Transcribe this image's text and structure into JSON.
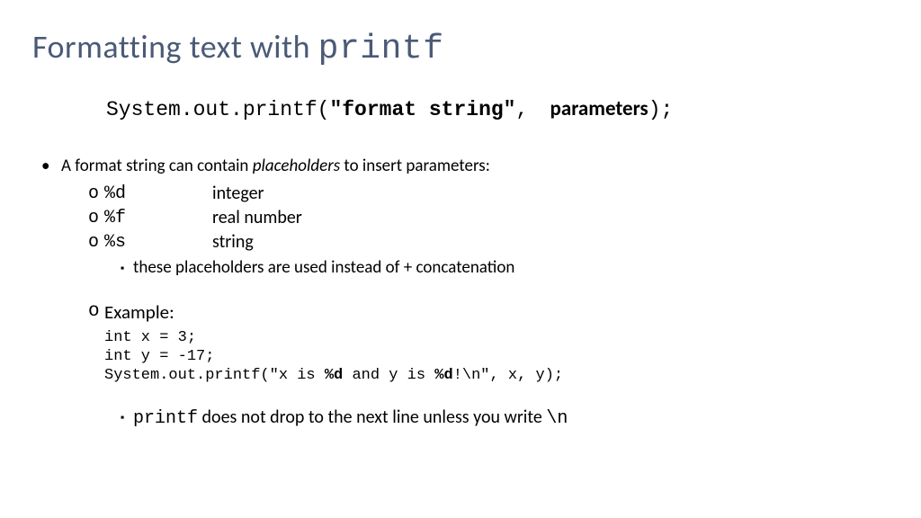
{
  "title": {
    "prefix": "Formatting text with ",
    "code": "printf"
  },
  "syntax": {
    "p1": "System.out.printf(",
    "p2": "\"format string\"",
    "p3": ", ",
    "p4": "parameters",
    "p5": ");"
  },
  "intro": {
    "pre": "A format string can contain ",
    "em": "placeholders",
    "post": " to insert parameters:"
  },
  "placeholders": [
    {
      "o": "o",
      "code": "%d",
      "desc": "integer"
    },
    {
      "o": "o",
      "code": "%f",
      "desc": "real number"
    },
    {
      "o": "o",
      "code": "%s",
      "desc": "string"
    }
  ],
  "subnote": "these placeholders are used instead of + concatenation",
  "example": {
    "o": "o",
    "label": "Example:",
    "line1": "int x = 3;",
    "line2": "int y = -17;",
    "line3_a": "System.out.printf(\"x is ",
    "line3_b": "%d",
    "line3_c": " and y is ",
    "line3_d": "%d",
    "line3_e": "!\\n\", x, y);"
  },
  "final": {
    "code1": "printf",
    "mid": " does not drop to the next line unless you write ",
    "code2": "\\n"
  }
}
